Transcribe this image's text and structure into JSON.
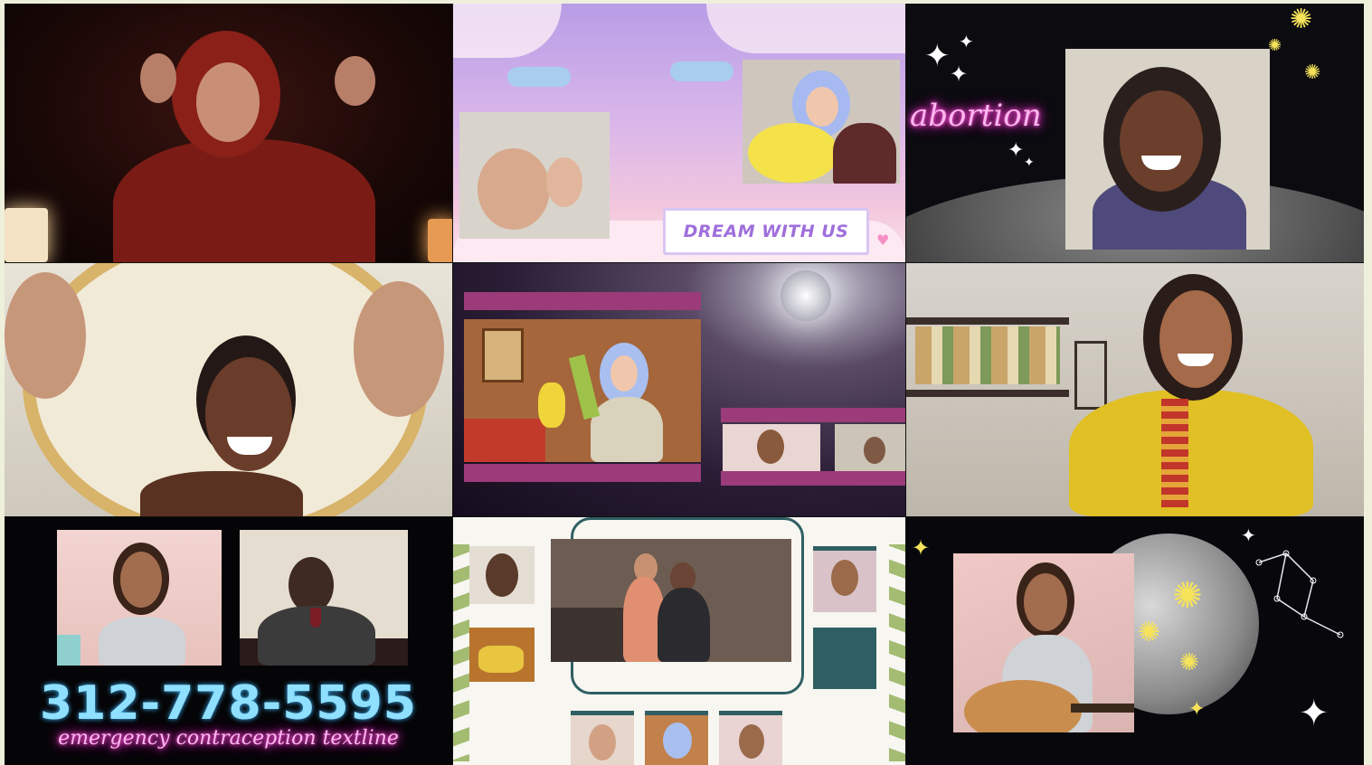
{
  "tiles": {
    "tile3": {
      "overlay_text": "abortion"
    },
    "tile2": {
      "badge_text": "DREAM WITH US"
    },
    "tile7": {
      "phone_number": "312-778-5595",
      "caption": "emergency contraception textline"
    }
  },
  "colors": {
    "neon_pink": "#ff4fd8",
    "phone_blue": "#8fe0ff",
    "lavender": "#b89de6",
    "teal_frame": "#2f5f63",
    "stage_magenta": "#9b3b7a"
  }
}
